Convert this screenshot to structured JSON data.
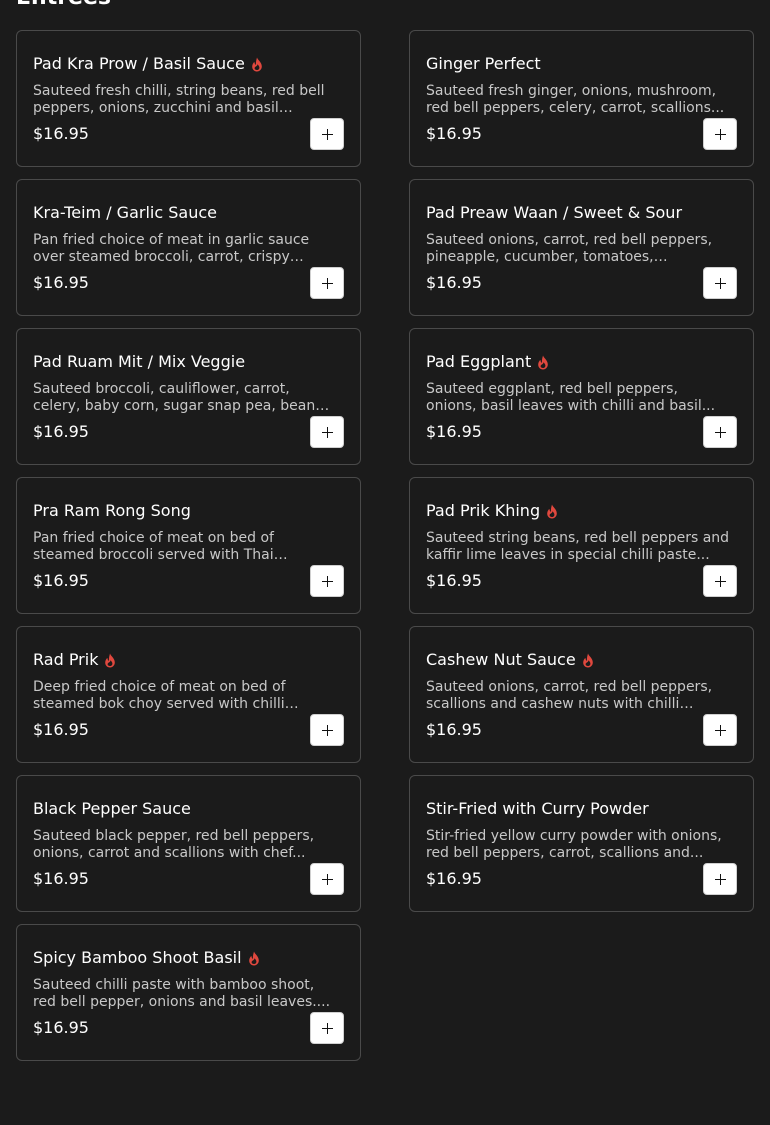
{
  "section": {
    "title": "Entrees"
  },
  "colors": {
    "spicy": "#e0483e",
    "background": "#1b1b1b",
    "card_border": "#4a4a4a"
  },
  "icons": {
    "spicy": "flame-icon",
    "add": "plus-icon"
  },
  "items": [
    {
      "name": "Pad Kra Prow / Basil Sauce",
      "spicy": true,
      "description": "Sauteed fresh chilli, string beans, red bell peppers, onions, zucchini and basil leaves...",
      "price": "$16.95"
    },
    {
      "name": "Ginger Perfect",
      "spicy": false,
      "description": "Sauteed fresh ginger, onions, mushroom, red bell peppers, celery, carrot, scallions...",
      "price": "$16.95"
    },
    {
      "name": "Kra-Teim / Garlic Sauce",
      "spicy": false,
      "description": "Pan fried choice of meat in garlic sauce over steamed broccoli, carrot, crispy garlic...",
      "price": "$16.95"
    },
    {
      "name": "Pad Preaw Waan / Sweet & Sour",
      "spicy": false,
      "description": "Sauteed onions, carrot, red bell peppers, pineapple, cucumber, tomatoes, scallions...",
      "price": "$16.95"
    },
    {
      "name": "Pad Ruam Mit / Mix Veggie",
      "spicy": false,
      "description": "Sauteed broccoli, cauliflower, carrot, celery, baby corn, sugar snap pea, bean sprouts,...",
      "price": "$16.95"
    },
    {
      "name": "Pad Eggplant",
      "spicy": true,
      "description": "Sauteed eggplant, red bell peppers, onions, basil leaves with chilli and basil...",
      "price": "$16.95"
    },
    {
      "name": "Pra Ram Rong Song",
      "spicy": false,
      "description": "Pan fried choice of meat on bed of steamed broccoli served with Thai peanut...",
      "price": "$16.95"
    },
    {
      "name": "Pad Prik Khing",
      "spicy": true,
      "description": "Sauteed string beans, red bell peppers and kaffir lime leaves in special chilli paste...",
      "price": "$16.95"
    },
    {
      "name": "Rad Prik",
      "spicy": true,
      "description": "Deep fried choice of meat on bed of steamed bok choy served with chilli garlic...",
      "price": "$16.95"
    },
    {
      "name": "Cashew Nut Sauce",
      "spicy": true,
      "description": "Sauteed onions, carrot, red bell peppers, scallions and cashew nuts with chilli paste...",
      "price": "$16.95"
    },
    {
      "name": "Black Pepper Sauce",
      "spicy": false,
      "description": "Sauteed black pepper, red bell peppers, onions, carrot and scallions with chef...",
      "price": "$16.95"
    },
    {
      "name": "Stir-Fried with Curry Powder",
      "spicy": false,
      "description": "Stir-fried yellow curry powder with onions, red bell peppers, carrot, scallions and...",
      "price": "$16.95"
    },
    {
      "name": "Spicy Bamboo Shoot Basil",
      "spicy": true,
      "description": "Sauteed chilli paste with bamboo shoot, red bell pepper, onions and basil leaves....",
      "price": "$16.95"
    }
  ]
}
